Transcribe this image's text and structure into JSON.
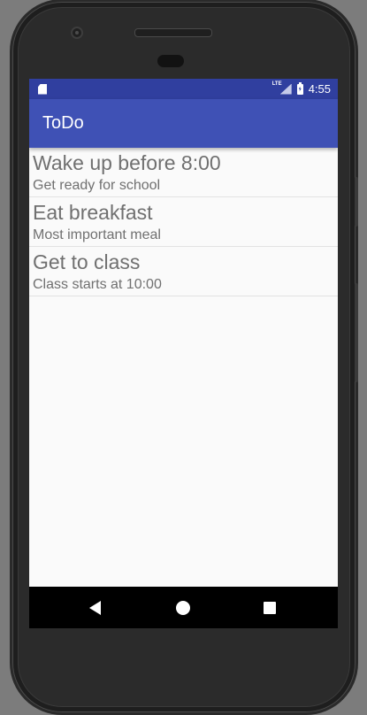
{
  "status_bar": {
    "network_label": "LTE",
    "time": "4:55",
    "icons": [
      "sd-card-icon",
      "lte-signal-icon",
      "battery-charging-icon"
    ]
  },
  "app_bar": {
    "title": "ToDo"
  },
  "todos": [
    {
      "title": "Wake up before 8:00",
      "subtitle": "Get ready for school"
    },
    {
      "title": "Eat breakfast",
      "subtitle": "Most important meal"
    },
    {
      "title": "Get to class",
      "subtitle": "Class starts at 10:00"
    }
  ],
  "nav_bar": {
    "buttons": [
      "back-icon",
      "home-icon",
      "recents-icon"
    ]
  },
  "colors": {
    "status_bar": "#303f9f",
    "app_bar": "#3f51b5",
    "screen_background": "#fafafa",
    "item_text": "#707070",
    "divider": "#e2e2e2",
    "nav_bar": "#000000"
  }
}
